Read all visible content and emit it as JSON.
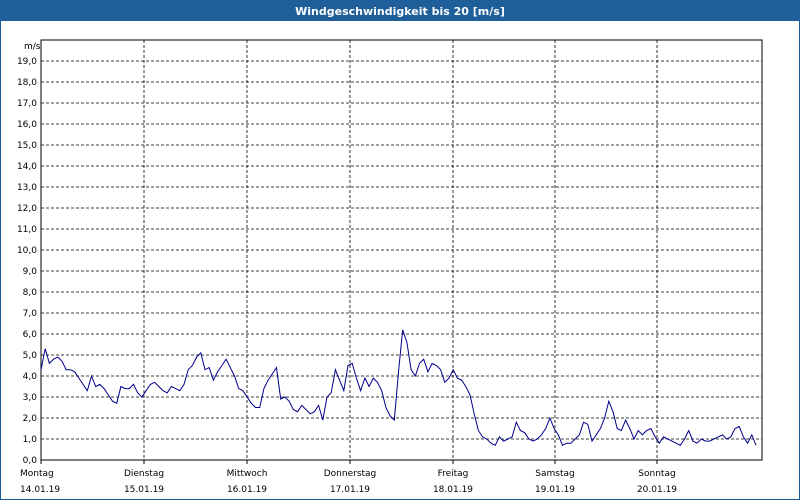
{
  "window": {
    "title": "Windgeschwindigkeit bis 20 [m/s]"
  },
  "colors": {
    "header": "#1f5f99",
    "line": "#00008b",
    "grid": "#000000"
  },
  "chart_data": {
    "type": "line",
    "title": "Windgeschwindigkeit bis 20 [m/s]",
    "ylabel": "m/s",
    "xlabel": "",
    "ylim": [
      0,
      20
    ],
    "yticks": [
      "0,0",
      "1,0",
      "2,0",
      "3,0",
      "4,0",
      "5,0",
      "6,0",
      "7,0",
      "8,0",
      "9,0",
      "10,0",
      "11,0",
      "12,0",
      "13,0",
      "14,0",
      "15,0",
      "16,0",
      "17,0",
      "18,0",
      "19,0"
    ],
    "grid": true,
    "days": [
      {
        "name": "Montag",
        "date": "14.01.19"
      },
      {
        "name": "Dienstag",
        "date": "15.01.19"
      },
      {
        "name": "Mittwoch",
        "date": "16.01.19"
      },
      {
        "name": "Donnerstag",
        "date": "17.01.19"
      },
      {
        "name": "Freitag",
        "date": "18.01.19"
      },
      {
        "name": "Samstag",
        "date": "19.01.19"
      },
      {
        "name": "Sonntag",
        "date": "20.01.19"
      }
    ],
    "series": [
      {
        "values": [
          4.3,
          5.3,
          4.6,
          4.8,
          4.9,
          4.7,
          4.3,
          4.3,
          4.2,
          3.9,
          3.6,
          3.3,
          4.0,
          3.5,
          3.6,
          3.4,
          3.1,
          2.8,
          2.7,
          3.5,
          3.4,
          3.4,
          3.6,
          3.2,
          3.0,
          3.3,
          3.6,
          3.7,
          3.5,
          3.3,
          3.2,
          3.5,
          3.4,
          3.3,
          3.6,
          4.3,
          4.5,
          4.9,
          5.1,
          4.3,
          4.4,
          3.8,
          4.2,
          4.5,
          4.8,
          4.4,
          4.0,
          3.4,
          3.3,
          3.0,
          2.7,
          2.5,
          2.5,
          3.4,
          3.8,
          4.1,
          4.4,
          2.9,
          3.0,
          2.8,
          2.4,
          2.3,
          2.6,
          2.4,
          2.2,
          2.3,
          2.6,
          1.9,
          3.0,
          3.2,
          4.3,
          3.8,
          3.3,
          4.5,
          4.6,
          3.9,
          3.3,
          3.9,
          3.5,
          3.9,
          3.7,
          3.3,
          2.5,
          2.1,
          1.9,
          4.2,
          6.2,
          5.6,
          4.3,
          4.0,
          4.6,
          4.8,
          4.2,
          4.6,
          4.5,
          4.3,
          3.7,
          3.9,
          4.3,
          3.9,
          3.8,
          3.5,
          3.1,
          2.2,
          1.4,
          1.1,
          1.0,
          0.8,
          0.7,
          1.1,
          0.9,
          1.0,
          1.1,
          1.8,
          1.4,
          1.3,
          1.0,
          0.9,
          1.0,
          1.2,
          1.5,
          2.0,
          1.5,
          1.2,
          0.7,
          0.8,
          0.8,
          1.0,
          1.2,
          1.8,
          1.7,
          0.9,
          1.2,
          1.5,
          2.0,
          2.8,
          2.3,
          1.5,
          1.4,
          1.9,
          1.5,
          1.0,
          1.4,
          1.2,
          1.4,
          1.5,
          1.1,
          0.8,
          1.1,
          1.0,
          0.9,
          0.8,
          0.7,
          1.0,
          1.4,
          0.9,
          0.8,
          1.0,
          0.9,
          0.9,
          1.0,
          1.1,
          1.2,
          1.0,
          1.1,
          1.5,
          1.6,
          1.1,
          0.8,
          1.2,
          0.7
        ]
      }
    ]
  }
}
